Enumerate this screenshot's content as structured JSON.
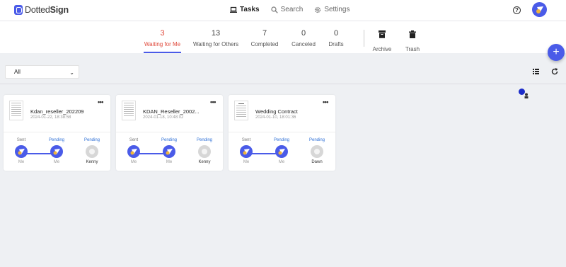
{
  "brand": {
    "name_light": "Dotted",
    "name_bold": "Sign"
  },
  "nav": [
    {
      "label": "Tasks",
      "icon": "laptop-icon",
      "active": true
    },
    {
      "label": "Search",
      "icon": "search-icon",
      "active": false
    },
    {
      "label": "Settings",
      "icon": "gear-icon",
      "active": false
    }
  ],
  "help_label": "?",
  "stats": [
    {
      "count": "3",
      "label": "Waiting for Me",
      "active": true
    },
    {
      "count": "13",
      "label": "Waiting for Others"
    },
    {
      "count": "7",
      "label": "Completed"
    },
    {
      "count": "0",
      "label": "Canceled"
    },
    {
      "count": "0",
      "label": "Drafts"
    }
  ],
  "bins": [
    {
      "label": "Archive",
      "icon": "archive-icon"
    },
    {
      "label": "Trash",
      "icon": "trash-icon"
    }
  ],
  "fab_label": "+",
  "filter": {
    "value": "All",
    "chevron": "⌄"
  },
  "more_label": "•••",
  "cards": [
    {
      "title": "Kdan_reseller_202209",
      "date": "2024-01-22, 18:38:58",
      "steps": [
        {
          "status": "Sent",
          "who": "Me"
        },
        {
          "status": "Pending",
          "who": "Me"
        },
        {
          "status": "Pending",
          "who": "Kenny"
        }
      ]
    },
    {
      "title": "KDAN_Reseller_2002...",
      "date": "2024-01-18, 10:48:02",
      "steps": [
        {
          "status": "Sent",
          "who": "Me"
        },
        {
          "status": "Pending",
          "who": "Me"
        },
        {
          "status": "Pending",
          "who": "Kenny"
        }
      ]
    },
    {
      "title": "Wedding Contract",
      "date": "2024-01-10, 18:01:36",
      "steps": [
        {
          "status": "Sent",
          "who": "Me"
        },
        {
          "status": "Pending",
          "who": "Me"
        },
        {
          "status": "Pending",
          "who": "Dawn"
        }
      ]
    }
  ],
  "colors": {
    "accent": "#4a5be8",
    "active_stat": "#e04a3c",
    "pending": "#2d6fd6"
  }
}
